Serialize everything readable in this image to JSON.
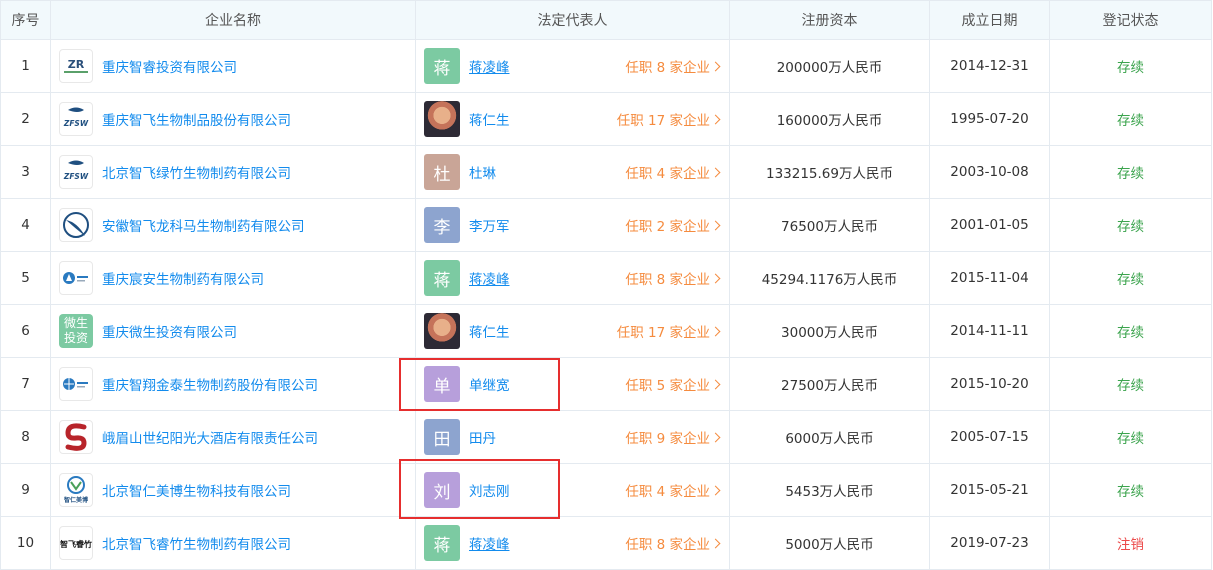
{
  "headers": [
    "序号",
    "企业名称",
    "法定代表人",
    "注册资本",
    "成立日期",
    "登记状态"
  ],
  "rows": [
    {
      "idx": "1",
      "name": "重庆智睿投资有限公司",
      "logo": {
        "type": "text",
        "text": "ZR",
        "icon": "zr-logo-icon"
      },
      "rep": "蒋凌峰",
      "rep_link": true,
      "avatar": {
        "type": "char",
        "char": "蒋",
        "color": "#7ccaa2"
      },
      "roles": "任职 8 家企业",
      "capital": "200000万人民币",
      "date": "2014-12-31",
      "status": "存续",
      "status_color": "green"
    },
    {
      "idx": "2",
      "name": "重庆智飞生物制品股份有限公司",
      "logo": {
        "type": "text",
        "text": "ZFSW",
        "icon": "zfsw-logo-icon"
      },
      "rep": "蒋仁生",
      "rep_link": false,
      "avatar": {
        "type": "photo",
        "char": "",
        "color": ""
      },
      "roles": "任职 17 家企业",
      "capital": "160000万人民币",
      "date": "1995-07-20",
      "status": "存续",
      "status_color": "green"
    },
    {
      "idx": "3",
      "name": "北京智飞绿竹生物制药有限公司",
      "logo": {
        "type": "text",
        "text": "ZFSW",
        "icon": "zfsw-logo-icon"
      },
      "rep": "杜琳",
      "rep_link": false,
      "avatar": {
        "type": "char",
        "char": "杜",
        "color": "#c9a597"
      },
      "roles": "任职 4 家企业",
      "capital": "133215.69万人民币",
      "date": "2003-10-08",
      "status": "存续",
      "status_color": "green"
    },
    {
      "idx": "4",
      "name": "安徽智飞龙科马生物制药有限公司",
      "logo": {
        "type": "text",
        "text": "",
        "icon": "swoosh-logo-icon"
      },
      "rep": "李万军",
      "rep_link": false,
      "avatar": {
        "type": "char",
        "char": "李",
        "color": "#8da4cf"
      },
      "roles": "任职 2 家企业",
      "capital": "76500万人民币",
      "date": "2001-01-05",
      "status": "存续",
      "status_color": "green"
    },
    {
      "idx": "5",
      "name": "重庆宸安生物制药有限公司",
      "logo": {
        "type": "text",
        "text": "",
        "icon": "triangle-logo-icon"
      },
      "rep": "蒋凌峰",
      "rep_link": true,
      "avatar": {
        "type": "char",
        "char": "蒋",
        "color": "#7ccaa2"
      },
      "roles": "任职 8 家企业",
      "capital": "45294.1176万人民币",
      "date": "2015-11-04",
      "status": "存续",
      "status_color": "green"
    },
    {
      "idx": "6",
      "name": "重庆微生投资有限公司",
      "logo": {
        "type": "green",
        "text": "微生投资",
        "icon": "text-logo-icon"
      },
      "rep": "蒋仁生",
      "rep_link": false,
      "avatar": {
        "type": "photo",
        "char": "",
        "color": ""
      },
      "roles": "任职 17 家企业",
      "capital": "30000万人民币",
      "date": "2014-11-11",
      "status": "存续",
      "status_color": "green"
    },
    {
      "idx": "7",
      "name": "重庆智翔金泰生物制药股份有限公司",
      "logo": {
        "type": "text",
        "text": "",
        "icon": "globe-logo-icon"
      },
      "rep": "单继宽",
      "rep_link": false,
      "avatar": {
        "type": "char",
        "char": "单",
        "color": "#b79fdb"
      },
      "roles": "任职 5 家企业",
      "capital": "27500万人民币",
      "date": "2015-10-20",
      "status": "存续",
      "status_color": "green"
    },
    {
      "idx": "8",
      "name": "峨眉山世纪阳光大酒店有限责任公司",
      "logo": {
        "type": "text",
        "text": "",
        "icon": "s-logo-icon"
      },
      "rep": "田丹",
      "rep_link": false,
      "avatar": {
        "type": "char",
        "char": "田",
        "color": "#8da4cf"
      },
      "roles": "任职 9 家企业",
      "capital": "6000万人民币",
      "date": "2005-07-15",
      "status": "存续",
      "status_color": "green"
    },
    {
      "idx": "9",
      "name": "北京智仁美博生物科技有限公司",
      "logo": {
        "type": "text",
        "text": "智仁美博",
        "icon": "zrmb-logo-icon"
      },
      "rep": "刘志刚",
      "rep_link": false,
      "avatar": {
        "type": "char",
        "char": "刘",
        "color": "#b79fdb"
      },
      "roles": "任职 4 家企业",
      "capital": "5453万人民币",
      "date": "2015-05-21",
      "status": "存续",
      "status_color": "green"
    },
    {
      "idx": "10",
      "name": "北京智飞睿竹生物制药有限公司",
      "logo": {
        "type": "text",
        "text": "智飞睿竹",
        "icon": "zfrz-logo-icon"
      },
      "rep": "蒋凌峰",
      "rep_link": true,
      "avatar": {
        "type": "char",
        "char": "蒋",
        "color": "#7ccaa2"
      },
      "roles": "任职 8 家企业",
      "capital": "5000万人民币",
      "date": "2019-07-23",
      "status": "注销",
      "status_color": "red"
    }
  ],
  "highlights": [
    7,
    9
  ],
  "colors": {
    "link": "#128bed",
    "orange": "#f58b3e",
    "green": "#3ca44e",
    "red": "#ec4b4b",
    "highlight": "#e62e2e"
  }
}
